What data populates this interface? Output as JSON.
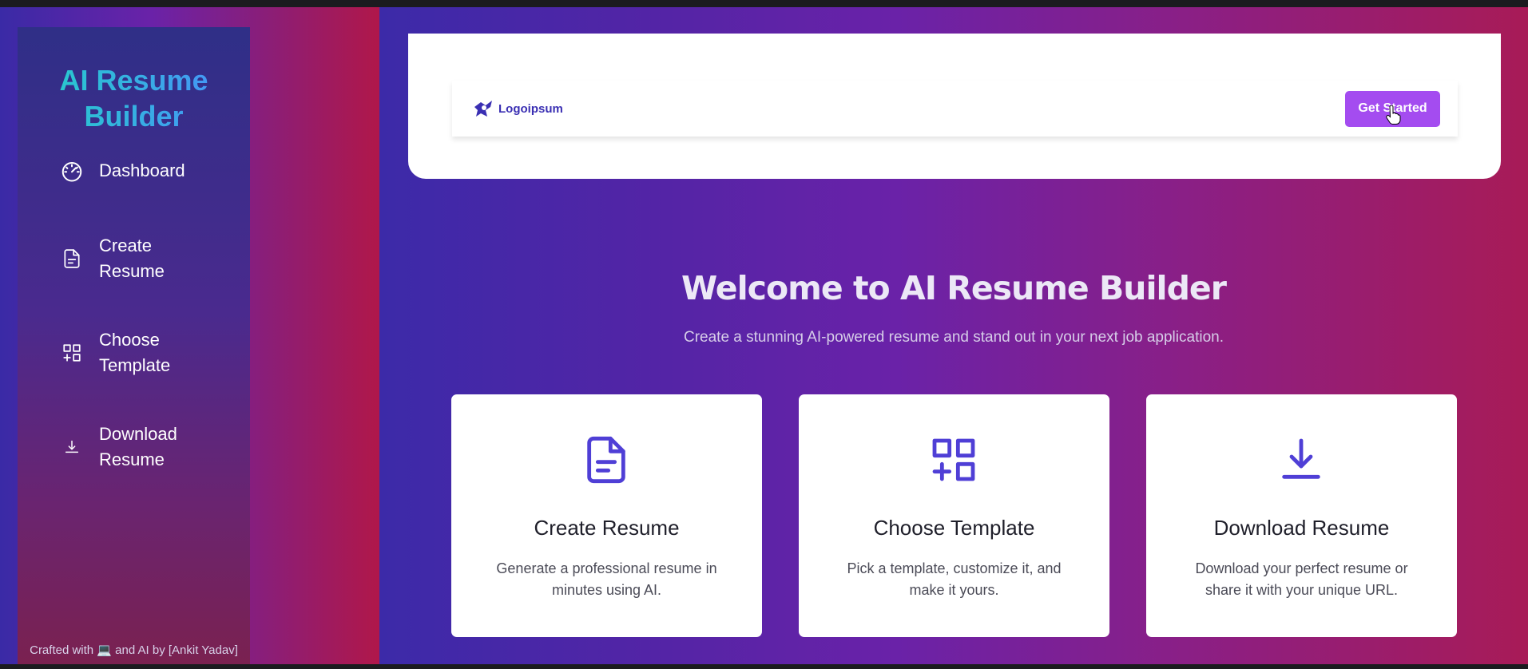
{
  "sidebar": {
    "title": "AI Resume Builder",
    "items": [
      {
        "label": "Dashboard",
        "icon": "gauge-icon"
      },
      {
        "label": "Create Resume",
        "icon": "file-text-icon"
      },
      {
        "label": "Choose Template",
        "icon": "grid-plus-icon"
      },
      {
        "label": "Download Resume",
        "icon": "download-icon"
      }
    ],
    "footer": "Crafted with 💻 and AI by [Ankit Yadav]"
  },
  "header": {
    "logo_text": "Logoipsum",
    "cta_label": "Get Started"
  },
  "hero": {
    "title": "Welcome to AI Resume Builder",
    "subtitle": "Create a stunning AI-powered resume and stand out in your next job application."
  },
  "features": [
    {
      "title": "Create Resume",
      "description": "Generate a professional resume in minutes using AI.",
      "icon": "file-text-icon"
    },
    {
      "title": "Choose Template",
      "description": "Pick a template, customize it, and make it yours.",
      "icon": "grid-plus-icon"
    },
    {
      "title": "Download Resume",
      "description": "Download your perfect resume or share it with your unique URL.",
      "icon": "download-icon"
    }
  ],
  "colors": {
    "accent": "#a44cf0",
    "icon": "#4f3fd6",
    "brand_gradient_start": "#22d3c5",
    "brand_gradient_end": "#4a8cff"
  }
}
